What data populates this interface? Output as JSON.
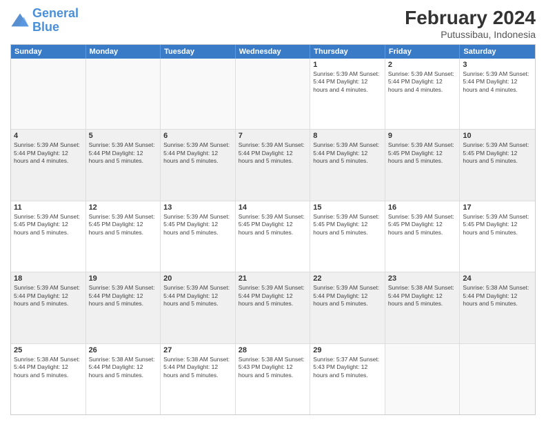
{
  "logo": {
    "text_general": "General",
    "text_blue": "Blue"
  },
  "header": {
    "title": "February 2024",
    "subtitle": "Putussibau, Indonesia"
  },
  "weekdays": [
    "Sunday",
    "Monday",
    "Tuesday",
    "Wednesday",
    "Thursday",
    "Friday",
    "Saturday"
  ],
  "weeks": [
    [
      {
        "day": "",
        "empty": true
      },
      {
        "day": "",
        "empty": true
      },
      {
        "day": "",
        "empty": true
      },
      {
        "day": "",
        "empty": true
      },
      {
        "day": "1",
        "info": "Sunrise: 5:39 AM\nSunset: 5:44 PM\nDaylight: 12 hours\nand 4 minutes."
      },
      {
        "day": "2",
        "info": "Sunrise: 5:39 AM\nSunset: 5:44 PM\nDaylight: 12 hours\nand 4 minutes."
      },
      {
        "day": "3",
        "info": "Sunrise: 5:39 AM\nSunset: 5:44 PM\nDaylight: 12 hours\nand 4 minutes."
      }
    ],
    [
      {
        "day": "4",
        "info": "Sunrise: 5:39 AM\nSunset: 5:44 PM\nDaylight: 12 hours\nand 4 minutes."
      },
      {
        "day": "5",
        "info": "Sunrise: 5:39 AM\nSunset: 5:44 PM\nDaylight: 12 hours\nand 5 minutes."
      },
      {
        "day": "6",
        "info": "Sunrise: 5:39 AM\nSunset: 5:44 PM\nDaylight: 12 hours\nand 5 minutes."
      },
      {
        "day": "7",
        "info": "Sunrise: 5:39 AM\nSunset: 5:44 PM\nDaylight: 12 hours\nand 5 minutes."
      },
      {
        "day": "8",
        "info": "Sunrise: 5:39 AM\nSunset: 5:44 PM\nDaylight: 12 hours\nand 5 minutes."
      },
      {
        "day": "9",
        "info": "Sunrise: 5:39 AM\nSunset: 5:45 PM\nDaylight: 12 hours\nand 5 minutes."
      },
      {
        "day": "10",
        "info": "Sunrise: 5:39 AM\nSunset: 5:45 PM\nDaylight: 12 hours\nand 5 minutes."
      }
    ],
    [
      {
        "day": "11",
        "info": "Sunrise: 5:39 AM\nSunset: 5:45 PM\nDaylight: 12 hours\nand 5 minutes."
      },
      {
        "day": "12",
        "info": "Sunrise: 5:39 AM\nSunset: 5:45 PM\nDaylight: 12 hours\nand 5 minutes."
      },
      {
        "day": "13",
        "info": "Sunrise: 5:39 AM\nSunset: 5:45 PM\nDaylight: 12 hours\nand 5 minutes."
      },
      {
        "day": "14",
        "info": "Sunrise: 5:39 AM\nSunset: 5:45 PM\nDaylight: 12 hours\nand 5 minutes."
      },
      {
        "day": "15",
        "info": "Sunrise: 5:39 AM\nSunset: 5:45 PM\nDaylight: 12 hours\nand 5 minutes."
      },
      {
        "day": "16",
        "info": "Sunrise: 5:39 AM\nSunset: 5:45 PM\nDaylight: 12 hours\nand 5 minutes."
      },
      {
        "day": "17",
        "info": "Sunrise: 5:39 AM\nSunset: 5:45 PM\nDaylight: 12 hours\nand 5 minutes."
      }
    ],
    [
      {
        "day": "18",
        "info": "Sunrise: 5:39 AM\nSunset: 5:44 PM\nDaylight: 12 hours\nand 5 minutes."
      },
      {
        "day": "19",
        "info": "Sunrise: 5:39 AM\nSunset: 5:44 PM\nDaylight: 12 hours\nand 5 minutes."
      },
      {
        "day": "20",
        "info": "Sunrise: 5:39 AM\nSunset: 5:44 PM\nDaylight: 12 hours\nand 5 minutes."
      },
      {
        "day": "21",
        "info": "Sunrise: 5:39 AM\nSunset: 5:44 PM\nDaylight: 12 hours\nand 5 minutes."
      },
      {
        "day": "22",
        "info": "Sunrise: 5:39 AM\nSunset: 5:44 PM\nDaylight: 12 hours\nand 5 minutes."
      },
      {
        "day": "23",
        "info": "Sunrise: 5:38 AM\nSunset: 5:44 PM\nDaylight: 12 hours\nand 5 minutes."
      },
      {
        "day": "24",
        "info": "Sunrise: 5:38 AM\nSunset: 5:44 PM\nDaylight: 12 hours\nand 5 minutes."
      }
    ],
    [
      {
        "day": "25",
        "info": "Sunrise: 5:38 AM\nSunset: 5:44 PM\nDaylight: 12 hours\nand 5 minutes."
      },
      {
        "day": "26",
        "info": "Sunrise: 5:38 AM\nSunset: 5:44 PM\nDaylight: 12 hours\nand 5 minutes."
      },
      {
        "day": "27",
        "info": "Sunrise: 5:38 AM\nSunset: 5:44 PM\nDaylight: 12 hours\nand 5 minutes."
      },
      {
        "day": "28",
        "info": "Sunrise: 5:38 AM\nSunset: 5:43 PM\nDaylight: 12 hours\nand 5 minutes."
      },
      {
        "day": "29",
        "info": "Sunrise: 5:37 AM\nSunset: 5:43 PM\nDaylight: 12 hours\nand 5 minutes."
      },
      {
        "day": "",
        "empty": true
      },
      {
        "day": "",
        "empty": true
      }
    ]
  ]
}
